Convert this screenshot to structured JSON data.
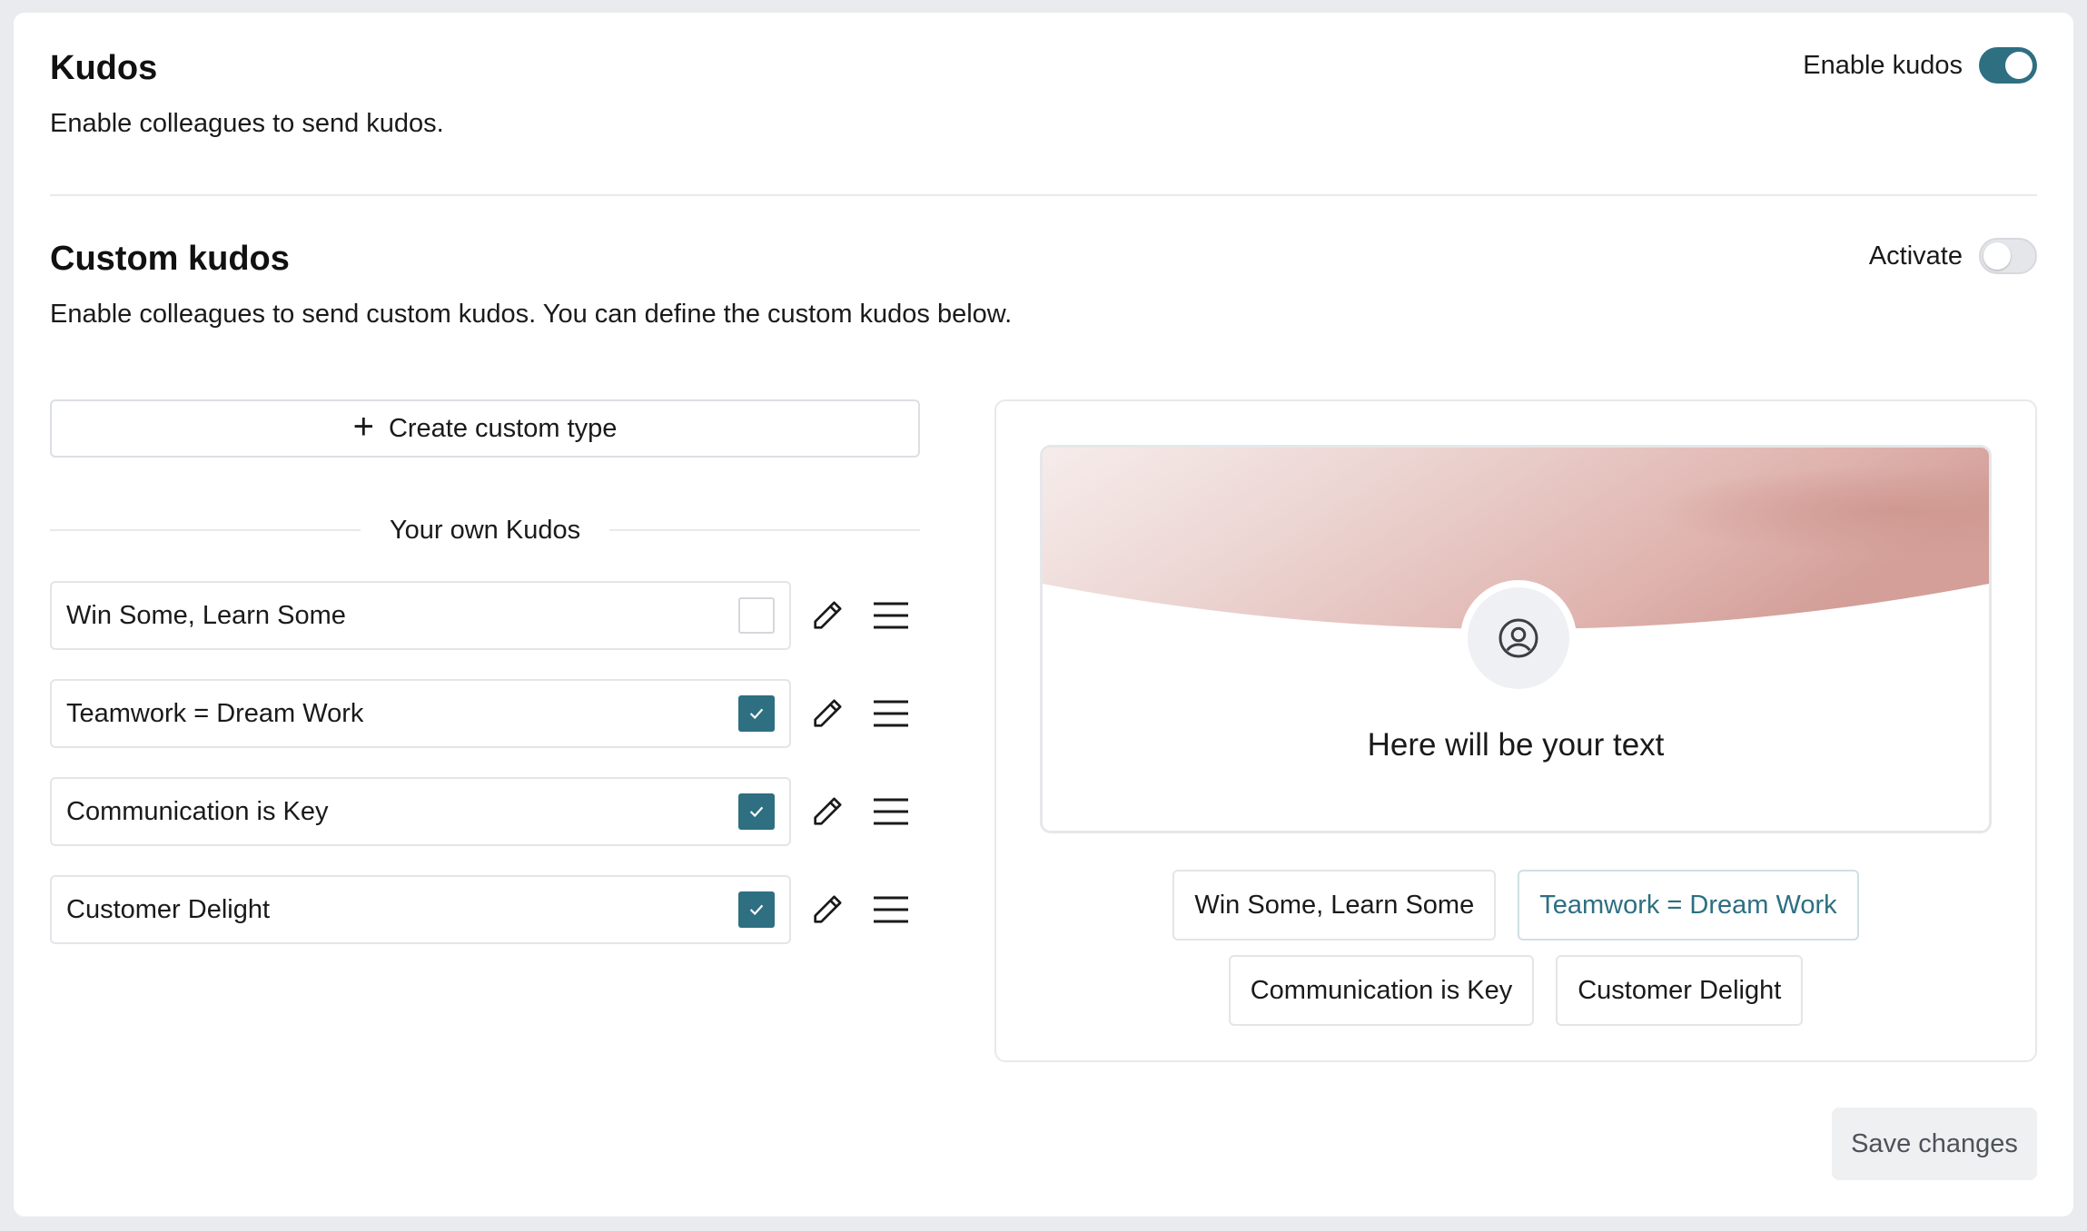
{
  "kudos": {
    "title": "Kudos",
    "description": "Enable colleagues to send kudos.",
    "toggle_label": "Enable kudos",
    "enabled": true
  },
  "custom": {
    "title": "Custom kudos",
    "description": "Enable colleagues to send custom kudos. You can define the custom kudos below.",
    "toggle_label": "Activate",
    "enabled": false
  },
  "create_button": {
    "label": "Create custom type",
    "icon": "plus-icon"
  },
  "list": {
    "section_label": "Your own Kudos",
    "items": [
      {
        "label": "Win Some, Learn Some",
        "checked": false
      },
      {
        "label": "Teamwork = Dream Work",
        "checked": true
      },
      {
        "label": "Communication is Key",
        "checked": true
      },
      {
        "label": "Customer Delight",
        "checked": true
      }
    ]
  },
  "preview": {
    "card_text": "Here will be your text",
    "chips": [
      {
        "label": "Win Some, Learn Some",
        "active": false
      },
      {
        "label": "Teamwork = Dream Work",
        "active": true
      },
      {
        "label": "Communication is Key",
        "active": false
      },
      {
        "label": "Customer Delight",
        "active": false
      }
    ]
  },
  "save_button": {
    "label": "Save changes"
  },
  "colors": {
    "accent": "#2e6f82",
    "card_gradient": "#d6a39d"
  }
}
